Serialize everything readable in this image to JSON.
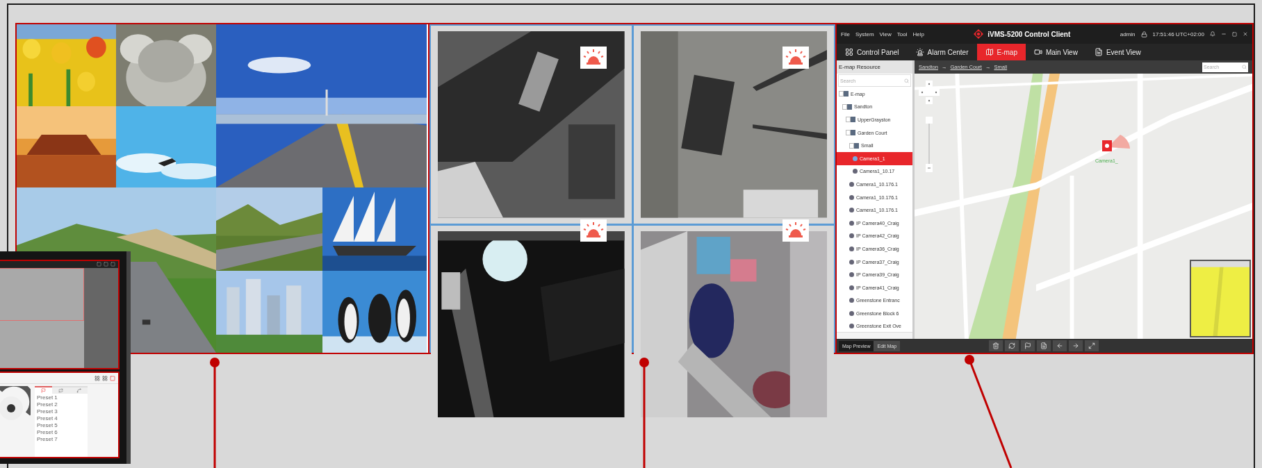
{
  "camera_wall": {
    "cells": [
      {
        "alarm": true
      },
      {
        "alarm": true
      },
      {
        "alarm": true
      },
      {
        "alarm": true
      }
    ]
  },
  "client": {
    "menu": [
      "File",
      "System",
      "View",
      "Tool",
      "Help"
    ],
    "title": "iVMS-5200 Control Client",
    "user": "admin",
    "time": "17:51:46 UTC+02:00",
    "tabs": [
      {
        "label": "Control Panel",
        "selected": false
      },
      {
        "label": "Alarm Center",
        "selected": false
      },
      {
        "label": "E-map",
        "selected": true
      },
      {
        "label": "Main View",
        "selected": false
      },
      {
        "label": "Event View",
        "selected": false
      }
    ],
    "resource_panel": {
      "title": "E-map Resource",
      "search": {
        "placeholder": "Search"
      },
      "tree": [
        {
          "label": "E-map",
          "kind": "map",
          "selected": false,
          "children": [
            {
              "label": "Sandton",
              "kind": "map",
              "selected": false,
              "children": [
                {
                  "label": "UpperGrayston",
                  "kind": "map",
                  "selected": false
                },
                {
                  "label": "Garden Court",
                  "kind": "map",
                  "selected": false,
                  "children": [
                    {
                      "label": "Small",
                      "kind": "map",
                      "selected": false,
                      "children": [
                        {
                          "label": "Camera1_1",
                          "kind": "camera",
                          "selected": true
                        },
                        {
                          "label": "Camera1_10.17",
                          "kind": "camera",
                          "selected": false
                        }
                      ]
                    },
                    {
                      "label": "Camera1_10.176.1",
                      "kind": "camera",
                      "selected": false
                    },
                    {
                      "label": "Camera1_10.176.1",
                      "kind": "camera",
                      "selected": false
                    },
                    {
                      "label": "Camera1_10.176.1",
                      "kind": "camera",
                      "selected": false
                    },
                    {
                      "label": "IP Camera40_Craig",
                      "kind": "camera",
                      "selected": false
                    },
                    {
                      "label": "IP Camera42_Craig",
                      "kind": "camera",
                      "selected": false
                    },
                    {
                      "label": "IP Camera36_Craig",
                      "kind": "camera",
                      "selected": false
                    },
                    {
                      "label": "IP Camera37_Craig",
                      "kind": "camera",
                      "selected": false
                    },
                    {
                      "label": "IP Camera39_Craig",
                      "kind": "camera",
                      "selected": false
                    },
                    {
                      "label": "IP Camera41_Craig",
                      "kind": "camera",
                      "selected": false
                    },
                    {
                      "label": "Greenstone Entranc",
                      "kind": "camera",
                      "selected": false
                    },
                    {
                      "label": "Greenstone Block 6",
                      "kind": "camera",
                      "selected": false
                    },
                    {
                      "label": "Greenstone Exit Ove",
                      "kind": "camera",
                      "selected": false
                    }
                  ]
                }
              ]
            }
          ]
        }
      ]
    },
    "breadcrumb": [
      {
        "label": "Sandton",
        "kind": "link"
      },
      {
        "label": "→",
        "kind": "separator"
      },
      {
        "label": "Garden Court",
        "kind": "link"
      },
      {
        "label": "→",
        "kind": "separator"
      },
      {
        "label": "Small",
        "kind": "link"
      }
    ],
    "map_search": {
      "placeholder": "Search"
    },
    "map": {
      "marker_label": "Camera1_"
    },
    "bottom_tabs": [
      {
        "label": "Map Preview",
        "selected": true
      },
      {
        "label": "Edit Map",
        "selected": false
      }
    ]
  },
  "ptz_window": {
    "ptz_tabs": [
      {
        "selected": true
      },
      {
        "selected": false
      },
      {
        "selected": false
      }
    ],
    "presets": [
      "Preset 1",
      "Preset 2",
      "Preset 3",
      "Preset 4",
      "Preset 5",
      "Preset 6",
      "Preset 7"
    ]
  }
}
